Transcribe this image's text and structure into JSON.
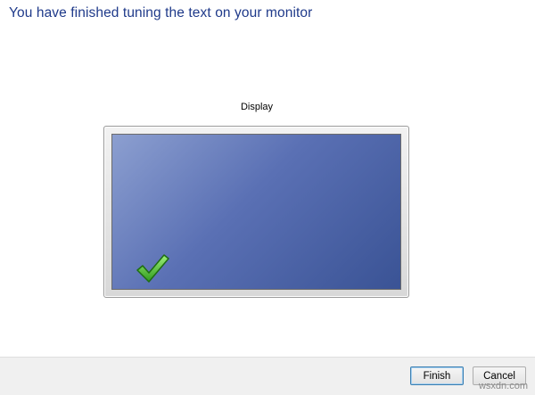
{
  "dialog": {
    "title": "You have finished tuning the text on your monitor",
    "display_label": "Display"
  },
  "buttons": {
    "finish": "Finish",
    "cancel": "Cancel"
  },
  "watermark": "wsxdn.com",
  "colors": {
    "title": "#1f3a8a",
    "screen_light": "#8c9fd0",
    "screen_dark": "#3a5395",
    "check": "#3fae2a"
  }
}
